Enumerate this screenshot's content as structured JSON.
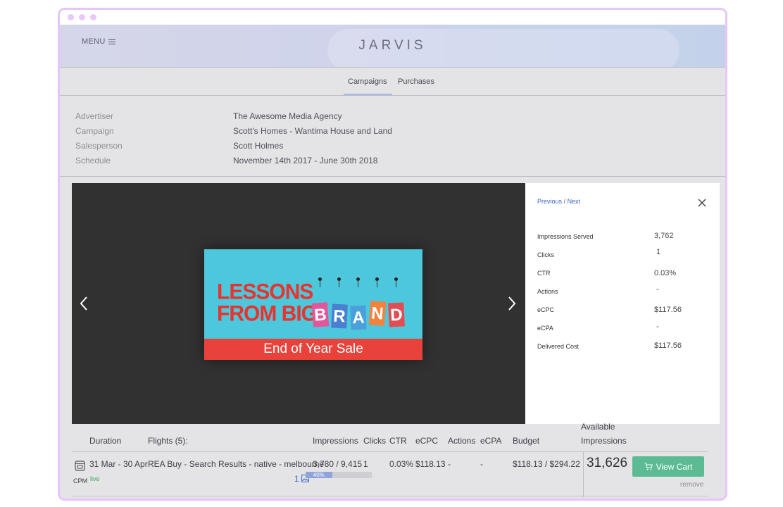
{
  "header": {
    "menu_label": "MENU",
    "brand": "JARVIS"
  },
  "tabs": [
    {
      "label": "Campaigns",
      "active": true
    },
    {
      "label": "Purchases",
      "active": false
    }
  ],
  "info": {
    "rows": [
      {
        "label": "Advertiser",
        "value": "The Awesome Media Agency"
      },
      {
        "label": "Campaign",
        "value": "Scott's Homes - Wantima House and Land"
      },
      {
        "label": "Salesperson",
        "value": "Scott Holmes"
      },
      {
        "label": "Schedule",
        "value": "November 14th 2017 - June 30th 2018"
      }
    ]
  },
  "creative": {
    "line1": "LESSONS",
    "line2": "FROM BIG",
    "brand_letters": [
      "B",
      "R",
      "A",
      "N",
      "D"
    ],
    "brand_colors": [
      "#e2569b",
      "#4b7fd1",
      "#4aa0dc",
      "#f2823c",
      "#e24c52"
    ],
    "strip": "End of Year Sale"
  },
  "stats": {
    "previous_label": "Previous",
    "separator": "/",
    "next_label": "Next",
    "rows": [
      {
        "label": "Impressions Served",
        "value": "3,762"
      },
      {
        "label": "Clicks",
        "value": "1"
      },
      {
        "label": "CTR",
        "value": "0.03%"
      },
      {
        "label": "Actions",
        "value": "-"
      },
      {
        "label": "eCPC",
        "value": "$117.56"
      },
      {
        "label": "eCPA",
        "value": "-"
      },
      {
        "label": "Delivered Cost",
        "value": "$117.56"
      }
    ]
  },
  "table": {
    "headers": {
      "duration": "Duration",
      "flights": "Flights (5):",
      "impressions": "Impressions",
      "clicks": "Clicks",
      "ctr": "CTR",
      "ecpc": "eCPC",
      "actions": "Actions",
      "ecpa": "eCPA",
      "budget": "Budget",
      "available_line1": "Available",
      "available_line2": "Impressions"
    },
    "row": {
      "type": "CPM",
      "status": "live",
      "duration": "31 Mar - 30 Apr",
      "flight": "REA Buy - Search Results - native - melbourne",
      "impressions": "3,780 / 9,415",
      "clicks": "1",
      "ctr": "0.03%",
      "ecpc": "$118.13",
      "actions": "-",
      "ecpa": "-",
      "budget": "$118.13 / $294.22",
      "creative_count": "1",
      "progress_label": "40%",
      "progress_value": 40,
      "available": "31,626",
      "cart_label": "View Cart",
      "remove_label": "remove"
    }
  },
  "colors": {
    "accent_green": "#5dbb94",
    "link_blue": "#3a67c7",
    "live_green": "#3aa655"
  }
}
